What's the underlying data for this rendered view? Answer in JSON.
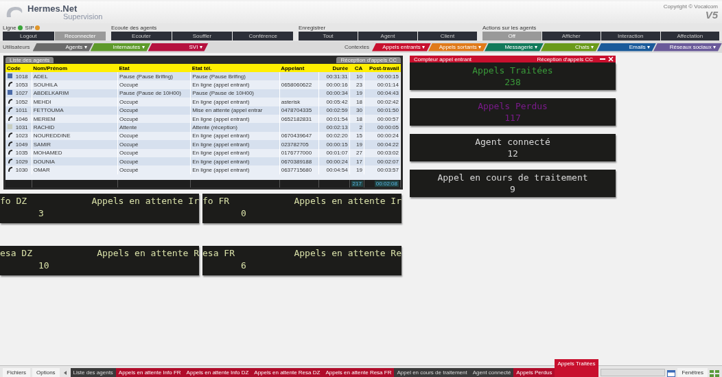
{
  "header": {
    "logo": "Hermes.Net",
    "subtitle": "Supervision",
    "copyright": "Copyright © Vocalcom",
    "version": "V5"
  },
  "toolbar": {
    "status": [
      {
        "label": "Ligne",
        "color": "#3aa63a"
      },
      {
        "label": "SIP",
        "color": "#e0962a"
      }
    ],
    "groups": [
      {
        "buttons": [
          {
            "label": "Logout",
            "selected": false
          },
          {
            "label": "Reconnecter",
            "selected": true
          }
        ]
      },
      {
        "title": "Ecoute des agents",
        "buttons": [
          {
            "label": "Ecouter",
            "selected": false
          },
          {
            "label": "Souffler",
            "selected": false
          },
          {
            "label": "Conférence",
            "selected": false
          }
        ]
      },
      {
        "title": "Enregistrer",
        "buttons": [
          {
            "label": "Tout",
            "selected": false
          },
          {
            "label": "Agent",
            "selected": false
          },
          {
            "label": "Client",
            "selected": false
          }
        ]
      },
      {
        "title": "Actions sur les agents",
        "buttons": [
          {
            "label": "Off",
            "selected": true
          },
          {
            "label": "Afficher",
            "selected": false
          },
          {
            "label": "Interaction",
            "selected": false
          },
          {
            "label": "Affectation",
            "selected": false
          }
        ]
      }
    ]
  },
  "ribbons": {
    "left_label": "Utilisateurs",
    "left": [
      {
        "label": "Agents ▾",
        "color": "#6a6a6a"
      },
      {
        "label": "Internautes ▾",
        "color": "#5e9a2a"
      },
      {
        "label": "SVI ▾",
        "color": "#b5123f"
      }
    ],
    "right_label": "Contextes",
    "right": [
      {
        "label": "Appels entrants ▾",
        "color": "#c8102e"
      },
      {
        "label": "Appels sortants ▾",
        "color": "#e07a1a"
      },
      {
        "label": "Messagerie ▾",
        "color": "#127a5a"
      },
      {
        "label": "Chats ▾",
        "color": "#6a9a1a"
      },
      {
        "label": "Emails ▾",
        "color": "#1a5a9a"
      },
      {
        "label": "Réseaux sociaux ▾",
        "color": "#6a5a9a"
      }
    ]
  },
  "agents_panel": {
    "tab": "Liste des agents",
    "filter": "Réception d'appels CC",
    "columns": [
      "Code",
      "Nom/Prénom",
      "Etat",
      "Etat tél.",
      "Appelant",
      "Durée",
      "CA",
      "Post-travail"
    ],
    "rows": [
      {
        "kind": "pause",
        "cells": [
          "1018",
          "ADEL",
          "Pause (Pause Brifing)",
          "Pause (Pause Brifing)",
          "",
          "00:31:31",
          "10",
          "00:00:15"
        ]
      },
      {
        "kind": "call",
        "cells": [
          "1053",
          "SOUHILA",
          "Occupé",
          "En ligne (appel entrant)",
          "0658060622",
          "00:00:16",
          "23",
          "00:01:14"
        ]
      },
      {
        "kind": "pause",
        "cells": [
          "1027",
          "ABDELKARIM",
          "Pause (Pause de 10H00)",
          "Pause (Pause de 10H00)",
          "",
          "00:00:34",
          "19",
          "00:04:43"
        ]
      },
      {
        "kind": "call",
        "cells": [
          "1052",
          "MEHDI",
          "Occupé",
          "En ligne (appel entrant)",
          "asterisk",
          "00:05:42",
          "18",
          "00:02:42"
        ]
      },
      {
        "kind": "call",
        "cells": [
          "1011",
          "FETTOUMA",
          "Occupé",
          "Mise en attente (appel entrar",
          "0478704335",
          "00:02:59",
          "30",
          "00:01:50"
        ]
      },
      {
        "kind": "call",
        "cells": [
          "1046",
          "MERIEM",
          "Occupé",
          "En ligne (appel entrant)",
          "0652182831",
          "00:01:54",
          "18",
          "00:00:57"
        ]
      },
      {
        "kind": "wait",
        "cells": [
          "1031",
          "RACHID",
          "Attente",
          "Attente (réception)",
          "",
          "00:02:13",
          "2",
          "00:00:05"
        ]
      },
      {
        "kind": "call",
        "cells": [
          "1023",
          "NOUREDDINE",
          "Occupé",
          "En ligne (appel entrant)",
          "0670439647",
          "00:02:20",
          "15",
          "00:00:24"
        ]
      },
      {
        "kind": "call",
        "cells": [
          "1049",
          "SAMIR",
          "Occupé",
          "En ligne (appel entrant)",
          "023782705",
          "00:00:15",
          "19",
          "00:04:22"
        ]
      },
      {
        "kind": "call",
        "cells": [
          "1035",
          "MOHAMED",
          "Occupé",
          "En ligne (appel entrant)",
          "0176777000",
          "00:01:07",
          "27",
          "00:03:02"
        ]
      },
      {
        "kind": "call",
        "cells": [
          "1029",
          "DOUNIA",
          "Occupé",
          "En ligne (appel entrant)",
          "0670389188",
          "00:00:24",
          "17",
          "00:02:07"
        ]
      },
      {
        "kind": "call",
        "cells": [
          "1030",
          "OMAR",
          "Occupé",
          "En ligne (appel entrant)",
          "0637715680",
          "00:04:54",
          "19",
          "00:03:57"
        ]
      }
    ],
    "totals": {
      "ca": "217",
      "post_travail": "00:02:08"
    }
  },
  "counters_panel": {
    "tab": "Compteur appel entrant",
    "filter": "Réception d'appels CC",
    "counters": [
      {
        "label": "Appels Traitées",
        "value": "238",
        "color": "#3a9a3a"
      },
      {
        "label": "Appels Perdus",
        "value": "117",
        "color": "#7a1a8a"
      },
      {
        "label": "Agent connecté",
        "value": "12",
        "color": "#d8d8d8"
      },
      {
        "label": "Appel en cours de traitement",
        "value": "9",
        "color": "#d8d8d8"
      }
    ]
  },
  "tickers": [
    {
      "name": "fo DZ",
      "label": "Appels en attente Ir",
      "value": "3"
    },
    {
      "name": "fo FR",
      "label": "Appels en attente Ir",
      "value": "0"
    },
    {
      "name": "esa DZ",
      "label": "Appels en attente R",
      "value": "10"
    },
    {
      "name": "esa FR",
      "label": "Appels en attente Re",
      "value": "6"
    }
  ],
  "taskbar": {
    "menus": [
      "Fichiers",
      "Options"
    ],
    "items": [
      {
        "label": "Liste des agents",
        "selected": false
      },
      {
        "label": "Appels en attente Info FR",
        "selected": false
      },
      {
        "label": "Appels en attente Info DZ",
        "selected": false
      },
      {
        "label": "Appels en attente Resa DZ",
        "selected": false
      },
      {
        "label": "Appels en attente Resa FR",
        "selected": false
      },
      {
        "label": "Appel en cours de traitement",
        "selected": false
      },
      {
        "label": "Agent connecté",
        "selected": false
      },
      {
        "label": "Appels Perdus",
        "selected": false
      },
      {
        "label": "Appels Traitées",
        "selected": true
      }
    ],
    "right_menu": "Fenêtres"
  }
}
